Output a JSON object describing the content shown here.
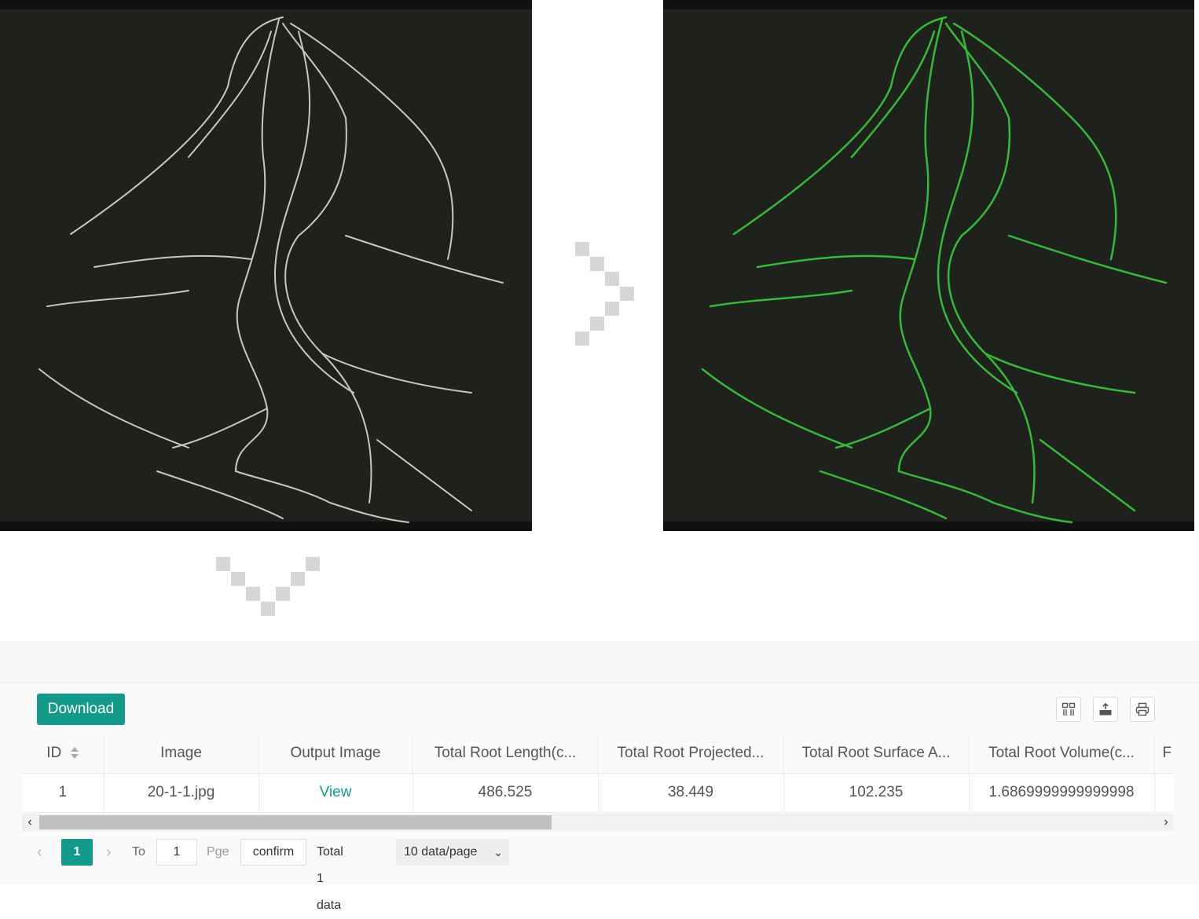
{
  "images": {
    "input_alt": "Original root scan",
    "output_alt": "Segmented root output"
  },
  "toolbar": {
    "download_label": "Download",
    "icons": [
      "columns-icon",
      "export-icon",
      "print-icon"
    ]
  },
  "table": {
    "columns": [
      "ID",
      "Image",
      "Output Image",
      "Total Root Length(c...",
      "Total Root Projected...",
      "Total Root Surface A...",
      "Total Root Volume(c...",
      "F"
    ],
    "rows": [
      [
        "1",
        "20-1-1.jpg",
        "View",
        "486.525",
        "38.449",
        "102.235",
        "1.6869999999999998",
        ""
      ]
    ]
  },
  "pagination": {
    "prev": "‹",
    "current_page": "1",
    "next": "›",
    "goto_label": "To",
    "goto_value": "1",
    "page_suffix": "Pge",
    "confirm_label": "confirm",
    "total_label": "Total 1 data",
    "page_size": "10 data/page"
  },
  "scroll": {
    "left_arrow": "‹",
    "right_arrow": "›"
  },
  "colors": {
    "accent": "#129b8a",
    "root_input": "#d8dcd0",
    "root_output": "#35c43a",
    "panel_bg": "#1f211c"
  }
}
